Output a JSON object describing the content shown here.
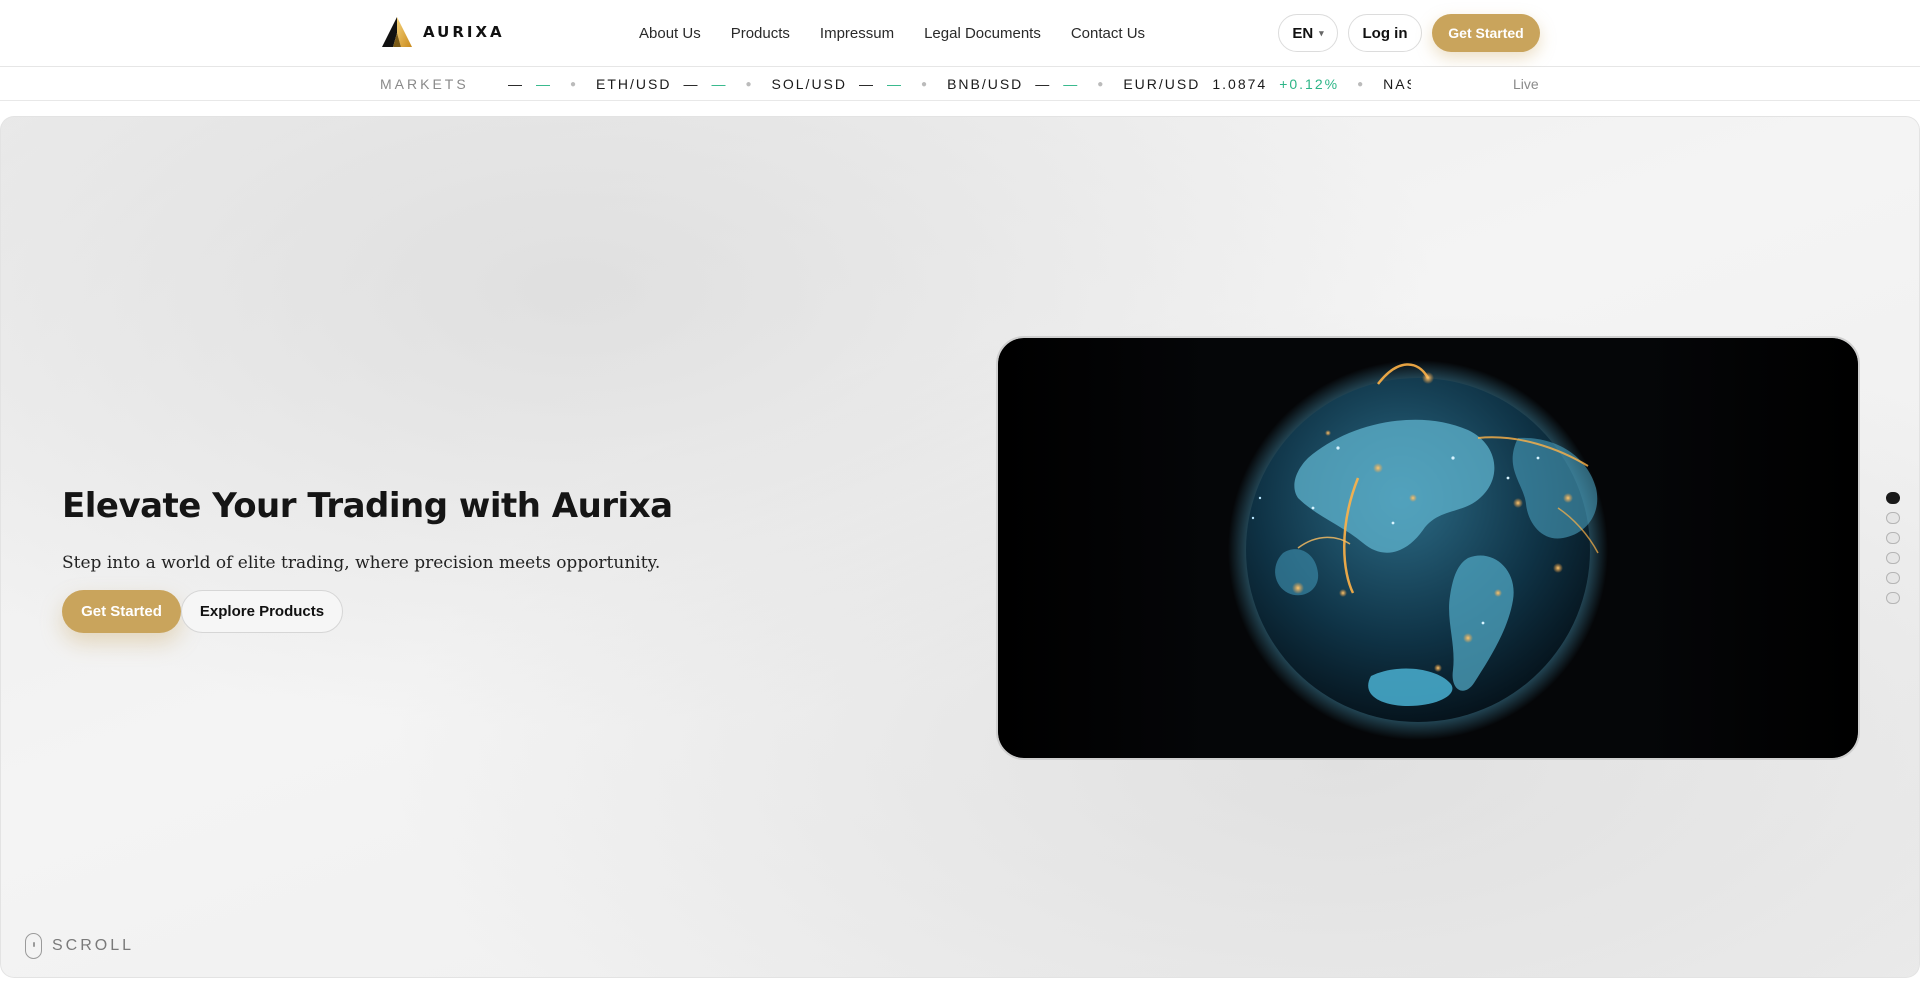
{
  "brand": {
    "name": "AURIXA"
  },
  "nav": {
    "items": [
      {
        "label": "About Us"
      },
      {
        "label": "Products"
      },
      {
        "label": "Impressum"
      },
      {
        "label": "Legal Documents"
      },
      {
        "label": "Contact Us"
      }
    ]
  },
  "header": {
    "language": "EN",
    "login_label": "Log in",
    "cta_label": "Get Started"
  },
  "ticker": {
    "label": "MARKETS",
    "status": "Live",
    "items": [
      {
        "symbol": "",
        "price": "—",
        "change": "—"
      },
      {
        "symbol": "ETH/USD",
        "price": "—",
        "change": "—"
      },
      {
        "symbol": "SOL/USD",
        "price": "—",
        "change": "—"
      },
      {
        "symbol": "BNB/USD",
        "price": "—",
        "change": "—"
      },
      {
        "symbol": "EUR/USD",
        "price": "1.0874",
        "change": "+0.12%"
      },
      {
        "symbol": "NASDAQ",
        "price": "",
        "change": ""
      }
    ]
  },
  "hero": {
    "title": "Elevate Your Trading with Aurixa",
    "subtitle": "Step into a world of elite trading, where precision meets opportunity.",
    "primary_cta": "Get Started",
    "secondary_cta": "Explore Products",
    "scroll_label": "SCROLL",
    "slides": {
      "count": 6,
      "active_index": 0
    }
  },
  "colors": {
    "accent_gold": "#c9a45c",
    "positive": "#2db587",
    "text_dark": "#151515"
  }
}
